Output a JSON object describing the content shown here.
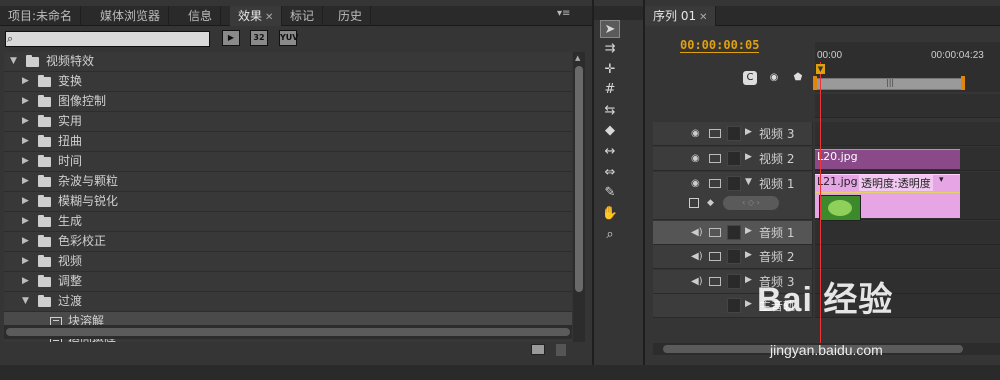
{
  "left_panel": {
    "tabs": [
      {
        "label": "项目:未命名"
      },
      {
        "label": "媒体浏览器"
      },
      {
        "label": "信息"
      },
      {
        "label": "效果"
      },
      {
        "label": "标记"
      },
      {
        "label": "历史"
      }
    ],
    "search": {
      "value": "",
      "placeholder": ""
    },
    "icon_buttons": [
      "32",
      "YUV"
    ],
    "tree": [
      {
        "label": "视频特效",
        "expanded": true,
        "level": 0
      },
      {
        "label": "变换",
        "expanded": false,
        "level": 1
      },
      {
        "label": "图像控制",
        "expanded": false,
        "level": 1
      },
      {
        "label": "实用",
        "expanded": false,
        "level": 1
      },
      {
        "label": "扭曲",
        "expanded": false,
        "level": 1
      },
      {
        "label": "时间",
        "expanded": false,
        "level": 1
      },
      {
        "label": "杂波与颗粒",
        "expanded": false,
        "level": 1
      },
      {
        "label": "模糊与锐化",
        "expanded": false,
        "level": 1
      },
      {
        "label": "生成",
        "expanded": false,
        "level": 1
      },
      {
        "label": "色彩校正",
        "expanded": false,
        "level": 1
      },
      {
        "label": "视频",
        "expanded": false,
        "level": 1
      },
      {
        "label": "调整",
        "expanded": false,
        "level": 1
      },
      {
        "label": "过渡",
        "expanded": true,
        "level": 1
      },
      {
        "label": "块溶解",
        "level": 2,
        "selected": true
      },
      {
        "label": "径向擦除",
        "level": 2
      }
    ]
  },
  "sequence": {
    "tab_label": "序列 01",
    "timecode": "00:00:00:05",
    "ruler": {
      "start": "00:00",
      "end": "00:00:04:23"
    },
    "tracks": [
      {
        "label": "视频 3",
        "kind": "video"
      },
      {
        "label": "视频 2",
        "kind": "video",
        "clip": "L20.jpg"
      },
      {
        "label": "视频 1",
        "kind": "video",
        "clip": "L21.jpg",
        "clip_fx": "透明度:透明度"
      },
      {
        "label": "音频 1",
        "kind": "audio",
        "selected": true
      },
      {
        "label": "音频 2",
        "kind": "audio"
      },
      {
        "label": "音频 3",
        "kind": "audio"
      },
      {
        "label": "主音轨",
        "kind": "master"
      }
    ]
  },
  "watermark": {
    "brand": "Bai 经验",
    "url": "jingyan.baidu.com"
  }
}
